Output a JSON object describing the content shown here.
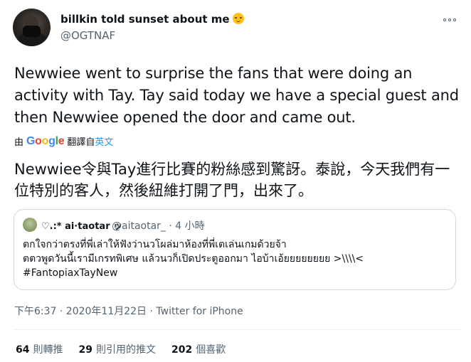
{
  "author": {
    "display_name": "billkin told sunset about me",
    "emoji": "relieved-face",
    "handle": "@OGTNAF"
  },
  "tweet": {
    "text": "Newwiee went to surprise the fans that were doing an activity with Tay. Tay said today we have a special guest and then Newwiee opened the door and came out.",
    "translate_prefix": "由",
    "translate_provider": "Google",
    "translate_label": "翻譯自",
    "translate_lang": "英文",
    "translated_text": "Newwiee令與Tay進行比賽的粉絲感到驚訝。泰說，今天我們有一位特別的客人，然後紐維打開了門，出來了。"
  },
  "quoted_tweet": {
    "name": "♡.:* ai⋅taotar ッ",
    "handle_time": "@aitaotar_ · 4 小時",
    "lines": [
      "ตกใจกว่าตรงที่พี่เล่าให้ฟังว่านวโผล่มาห้องที่พี่เตเล่นเกมด้วยจ้า",
      "ตตวพูดวันนี้เรามีเกรทพิเศษ แล้วนวก็เปิดประตูออกมา ไอบ้าเอ้ยยยยยยยย >\\\\\\\\<",
      "#FantopiaxTayNew"
    ]
  },
  "meta": {
    "timestamp": "下午6:37 · 2020年11月22日 · Twitter for iPhone"
  },
  "stats": [
    {
      "count": "64",
      "label": "則轉推"
    },
    {
      "count": "29",
      "label": "則引用的推文"
    },
    {
      "count": "202",
      "label": "個喜歡"
    }
  ],
  "colors": {
    "text": "#0f1419",
    "muted": "#536471",
    "link": "#1d9bf0",
    "border": "#cfd9de"
  }
}
